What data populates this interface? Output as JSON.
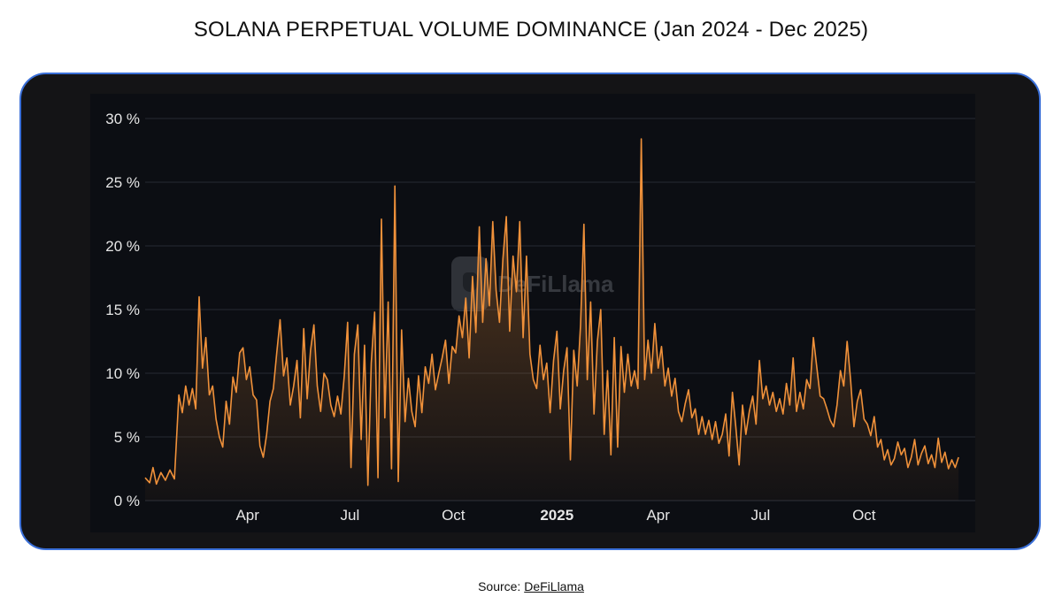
{
  "title": "SOLANA PERPETUAL VOLUME DOMINANCE (Jan 2024 - Dec 2025)",
  "source": {
    "prefix": "Source: ",
    "link_text": "DeFiLlama"
  },
  "watermark": {
    "text": "DeFiLlama",
    "icon": "llama-logo-icon"
  },
  "colors": {
    "line": "#f0913a",
    "frame_border": "#3a6fd8",
    "frame_bg": "#141416",
    "plot_bg": "#0c0e13",
    "axis_text": "#e6e6e6"
  },
  "chart_data": {
    "type": "area",
    "title": "SOLANA PERPETUAL VOLUME DOMINANCE (Jan 2024 - Dec 2025)",
    "xlabel": "",
    "ylabel": "",
    "x_range": [
      "2024-01-01",
      "2025-12-31"
    ],
    "ylim": [
      0,
      30
    ],
    "y_unit": "%",
    "y_ticks": [
      0,
      5,
      10,
      15,
      20,
      25,
      30
    ],
    "y_tick_labels": [
      "0 %",
      "5 %",
      "10 %",
      "15 %",
      "20 %",
      "25 %",
      "30 %"
    ],
    "x_ticks": [
      {
        "date": "2024-04-01",
        "label": "Apr",
        "bold": false
      },
      {
        "date": "2024-07-01",
        "label": "Jul",
        "bold": false
      },
      {
        "date": "2024-10-01",
        "label": "Oct",
        "bold": false
      },
      {
        "date": "2025-01-01",
        "label": "2025",
        "bold": true
      },
      {
        "date": "2025-04-01",
        "label": "Apr",
        "bold": false
      },
      {
        "date": "2025-07-01",
        "label": "Jul",
        "bold": false
      },
      {
        "date": "2025-10-01",
        "label": "Oct",
        "bold": false
      }
    ],
    "grid": true,
    "series": [
      {
        "points": [
          [
            "2024-01-01",
            1.8
          ],
          [
            "2024-01-05",
            1.4
          ],
          [
            "2024-01-08",
            2.6
          ],
          [
            "2024-01-11",
            1.3
          ],
          [
            "2024-01-15",
            2.2
          ],
          [
            "2024-01-19",
            1.6
          ],
          [
            "2024-01-23",
            2.4
          ],
          [
            "2024-01-27",
            1.7
          ],
          [
            "2024-01-31",
            8.3
          ],
          [
            "2024-02-03",
            6.9
          ],
          [
            "2024-02-06",
            9.0
          ],
          [
            "2024-02-09",
            7.5
          ],
          [
            "2024-02-12",
            8.8
          ],
          [
            "2024-02-15",
            7.2
          ],
          [
            "2024-02-18",
            16.0
          ],
          [
            "2024-02-21",
            10.4
          ],
          [
            "2024-02-24",
            12.8
          ],
          [
            "2024-02-27",
            8.3
          ],
          [
            "2024-03-01",
            9.0
          ],
          [
            "2024-03-04",
            6.4
          ],
          [
            "2024-03-07",
            5.0
          ],
          [
            "2024-03-10",
            4.2
          ],
          [
            "2024-03-13",
            7.8
          ],
          [
            "2024-03-16",
            6.0
          ],
          [
            "2024-03-19",
            9.7
          ],
          [
            "2024-03-22",
            8.5
          ],
          [
            "2024-03-25",
            11.6
          ],
          [
            "2024-03-28",
            12.0
          ],
          [
            "2024-03-31",
            9.5
          ],
          [
            "2024-04-03",
            10.5
          ],
          [
            "2024-04-06",
            8.3
          ],
          [
            "2024-04-09",
            7.9
          ],
          [
            "2024-04-12",
            4.3
          ],
          [
            "2024-04-15",
            3.4
          ],
          [
            "2024-04-18",
            5.2
          ],
          [
            "2024-04-21",
            7.8
          ],
          [
            "2024-04-24",
            8.8
          ],
          [
            "2024-04-27",
            11.6
          ],
          [
            "2024-04-30",
            14.2
          ],
          [
            "2024-05-03",
            9.8
          ],
          [
            "2024-05-06",
            11.2
          ],
          [
            "2024-05-09",
            7.5
          ],
          [
            "2024-05-12",
            9.0
          ],
          [
            "2024-05-15",
            11.0
          ],
          [
            "2024-05-18",
            6.5
          ],
          [
            "2024-05-21",
            13.5
          ],
          [
            "2024-05-24",
            8.0
          ],
          [
            "2024-05-27",
            11.8
          ],
          [
            "2024-05-30",
            13.8
          ],
          [
            "2024-06-02",
            9.0
          ],
          [
            "2024-06-05",
            7.0
          ],
          [
            "2024-06-08",
            10.0
          ],
          [
            "2024-06-11",
            9.5
          ],
          [
            "2024-06-14",
            7.5
          ],
          [
            "2024-06-17",
            6.6
          ],
          [
            "2024-06-20",
            8.2
          ],
          [
            "2024-06-23",
            6.8
          ],
          [
            "2024-06-26",
            9.8
          ],
          [
            "2024-06-29",
            14.0
          ],
          [
            "2024-07-02",
            2.6
          ],
          [
            "2024-07-05",
            11.5
          ],
          [
            "2024-07-08",
            13.8
          ],
          [
            "2024-07-11",
            4.8
          ],
          [
            "2024-07-14",
            12.2
          ],
          [
            "2024-07-17",
            1.2
          ],
          [
            "2024-07-20",
            10.8
          ],
          [
            "2024-07-23",
            14.8
          ],
          [
            "2024-07-26",
            1.8
          ],
          [
            "2024-07-29",
            22.1
          ],
          [
            "2024-08-01",
            6.5
          ],
          [
            "2024-08-04",
            15.6
          ],
          [
            "2024-08-07",
            2.5
          ],
          [
            "2024-08-10",
            24.7
          ],
          [
            "2024-08-13",
            1.5
          ],
          [
            "2024-08-16",
            13.4
          ],
          [
            "2024-08-19",
            6.2
          ],
          [
            "2024-08-22",
            9.6
          ],
          [
            "2024-08-25",
            7.0
          ],
          [
            "2024-08-28",
            5.8
          ],
          [
            "2024-08-31",
            9.8
          ],
          [
            "2024-09-03",
            6.9
          ],
          [
            "2024-09-06",
            10.5
          ],
          [
            "2024-09-09",
            9.2
          ],
          [
            "2024-09-12",
            11.5
          ],
          [
            "2024-09-15",
            8.7
          ],
          [
            "2024-09-18",
            10.0
          ],
          [
            "2024-09-21",
            11.2
          ],
          [
            "2024-09-24",
            12.6
          ],
          [
            "2024-09-27",
            9.2
          ],
          [
            "2024-09-30",
            12.1
          ],
          [
            "2024-10-03",
            11.6
          ],
          [
            "2024-10-06",
            14.5
          ],
          [
            "2024-10-09",
            12.8
          ],
          [
            "2024-10-12",
            15.9
          ],
          [
            "2024-10-15",
            11.2
          ],
          [
            "2024-10-18",
            17.6
          ],
          [
            "2024-10-21",
            13.2
          ],
          [
            "2024-10-24",
            21.5
          ],
          [
            "2024-10-27",
            14.0
          ],
          [
            "2024-10-30",
            19.0
          ],
          [
            "2024-11-02",
            15.3
          ],
          [
            "2024-11-05",
            21.9
          ],
          [
            "2024-11-08",
            16.5
          ],
          [
            "2024-11-11",
            14.0
          ],
          [
            "2024-11-14",
            19.0
          ],
          [
            "2024-11-17",
            22.3
          ],
          [
            "2024-11-20",
            13.3
          ],
          [
            "2024-11-23",
            19.2
          ],
          [
            "2024-11-26",
            16.4
          ],
          [
            "2024-11-29",
            21.9
          ],
          [
            "2024-12-02",
            12.8
          ],
          [
            "2024-12-05",
            19.2
          ],
          [
            "2024-12-08",
            11.5
          ],
          [
            "2024-12-11",
            9.5
          ],
          [
            "2024-12-14",
            8.8
          ],
          [
            "2024-12-17",
            12.2
          ],
          [
            "2024-12-20",
            9.5
          ],
          [
            "2024-12-23",
            10.8
          ],
          [
            "2024-12-26",
            6.9
          ],
          [
            "2024-12-29",
            11.0
          ],
          [
            "2025-01-01",
            13.3
          ],
          [
            "2025-01-04",
            7.2
          ],
          [
            "2025-01-07",
            10.2
          ],
          [
            "2025-01-10",
            12.0
          ],
          [
            "2025-01-13",
            3.2
          ],
          [
            "2025-01-16",
            11.8
          ],
          [
            "2025-01-19",
            9.0
          ],
          [
            "2025-01-22",
            13.8
          ],
          [
            "2025-01-25",
            21.7
          ],
          [
            "2025-01-28",
            9.5
          ],
          [
            "2025-01-31",
            15.6
          ],
          [
            "2025-02-03",
            6.8
          ],
          [
            "2025-02-06",
            12.5
          ],
          [
            "2025-02-09",
            15.0
          ],
          [
            "2025-02-12",
            5.2
          ],
          [
            "2025-02-15",
            10.2
          ],
          [
            "2025-02-18",
            3.6
          ],
          [
            "2025-02-21",
            12.8
          ],
          [
            "2025-02-24",
            4.2
          ],
          [
            "2025-02-27",
            12.1
          ],
          [
            "2025-03-02",
            8.5
          ],
          [
            "2025-03-05",
            11.5
          ],
          [
            "2025-03-08",
            9.0
          ],
          [
            "2025-03-11",
            10.2
          ],
          [
            "2025-03-14",
            8.8
          ],
          [
            "2025-03-17",
            28.4
          ],
          [
            "2025-03-20",
            9.5
          ],
          [
            "2025-03-23",
            12.6
          ],
          [
            "2025-03-26",
            10.0
          ],
          [
            "2025-03-29",
            13.9
          ],
          [
            "2025-04-01",
            10.4
          ],
          [
            "2025-04-04",
            12.1
          ],
          [
            "2025-04-07",
            9.0
          ],
          [
            "2025-04-10",
            10.4
          ],
          [
            "2025-04-13",
            8.2
          ],
          [
            "2025-04-16",
            9.6
          ],
          [
            "2025-04-19",
            7.0
          ],
          [
            "2025-04-22",
            6.2
          ],
          [
            "2025-04-25",
            7.6
          ],
          [
            "2025-04-28",
            8.7
          ],
          [
            "2025-05-01",
            6.5
          ],
          [
            "2025-05-04",
            7.2
          ],
          [
            "2025-05-07",
            5.2
          ],
          [
            "2025-05-10",
            6.6
          ],
          [
            "2025-05-13",
            5.2
          ],
          [
            "2025-05-16",
            6.3
          ],
          [
            "2025-05-19",
            4.8
          ],
          [
            "2025-05-22",
            6.2
          ],
          [
            "2025-05-25",
            4.5
          ],
          [
            "2025-05-28",
            5.2
          ],
          [
            "2025-05-31",
            6.8
          ],
          [
            "2025-06-03",
            3.5
          ],
          [
            "2025-06-06",
            8.5
          ],
          [
            "2025-06-09",
            5.8
          ],
          [
            "2025-06-12",
            2.8
          ],
          [
            "2025-06-15",
            7.5
          ],
          [
            "2025-06-18",
            5.2
          ],
          [
            "2025-06-21",
            7.0
          ],
          [
            "2025-06-24",
            8.2
          ],
          [
            "2025-06-27",
            6.0
          ],
          [
            "2025-06-30",
            11.0
          ],
          [
            "2025-07-03",
            8.0
          ],
          [
            "2025-07-06",
            9.0
          ],
          [
            "2025-07-09",
            7.5
          ],
          [
            "2025-07-12",
            8.5
          ],
          [
            "2025-07-15",
            7.0
          ],
          [
            "2025-07-18",
            8.0
          ],
          [
            "2025-07-21",
            6.8
          ],
          [
            "2025-07-24",
            9.2
          ],
          [
            "2025-07-27",
            7.5
          ],
          [
            "2025-07-30",
            11.2
          ],
          [
            "2025-08-02",
            7.0
          ],
          [
            "2025-08-05",
            8.5
          ],
          [
            "2025-08-08",
            7.2
          ],
          [
            "2025-08-11",
            9.5
          ],
          [
            "2025-08-14",
            8.8
          ],
          [
            "2025-08-17",
            12.8
          ],
          [
            "2025-08-20",
            10.5
          ],
          [
            "2025-08-23",
            8.2
          ],
          [
            "2025-08-26",
            8.0
          ],
          [
            "2025-08-29",
            7.2
          ],
          [
            "2025-09-01",
            6.3
          ],
          [
            "2025-09-04",
            5.8
          ],
          [
            "2025-09-07",
            7.5
          ],
          [
            "2025-09-10",
            10.2
          ],
          [
            "2025-09-13",
            9.0
          ],
          [
            "2025-09-16",
            12.5
          ],
          [
            "2025-09-19",
            9.5
          ],
          [
            "2025-09-22",
            5.8
          ],
          [
            "2025-09-25",
            7.8
          ],
          [
            "2025-09-28",
            8.7
          ],
          [
            "2025-10-01",
            6.4
          ],
          [
            "2025-10-04",
            6.0
          ],
          [
            "2025-10-07",
            5.1
          ],
          [
            "2025-10-10",
            6.6
          ],
          [
            "2025-10-13",
            4.2
          ],
          [
            "2025-10-16",
            4.8
          ],
          [
            "2025-10-19",
            3.2
          ],
          [
            "2025-10-22",
            4.0
          ],
          [
            "2025-10-25",
            2.8
          ],
          [
            "2025-10-28",
            3.3
          ],
          [
            "2025-10-31",
            4.6
          ],
          [
            "2025-11-03",
            3.6
          ],
          [
            "2025-11-06",
            4.1
          ],
          [
            "2025-11-09",
            2.6
          ],
          [
            "2025-11-12",
            3.4
          ],
          [
            "2025-11-15",
            4.8
          ],
          [
            "2025-11-18",
            2.8
          ],
          [
            "2025-11-21",
            3.7
          ],
          [
            "2025-11-24",
            4.3
          ],
          [
            "2025-11-27",
            2.9
          ],
          [
            "2025-11-30",
            3.6
          ],
          [
            "2025-12-03",
            2.6
          ],
          [
            "2025-12-06",
            4.9
          ],
          [
            "2025-12-09",
            3.0
          ],
          [
            "2025-12-12",
            3.8
          ],
          [
            "2025-12-15",
            2.5
          ],
          [
            "2025-12-18",
            3.2
          ],
          [
            "2025-12-21",
            2.6
          ],
          [
            "2025-12-24",
            3.4
          ]
        ]
      }
    ]
  }
}
